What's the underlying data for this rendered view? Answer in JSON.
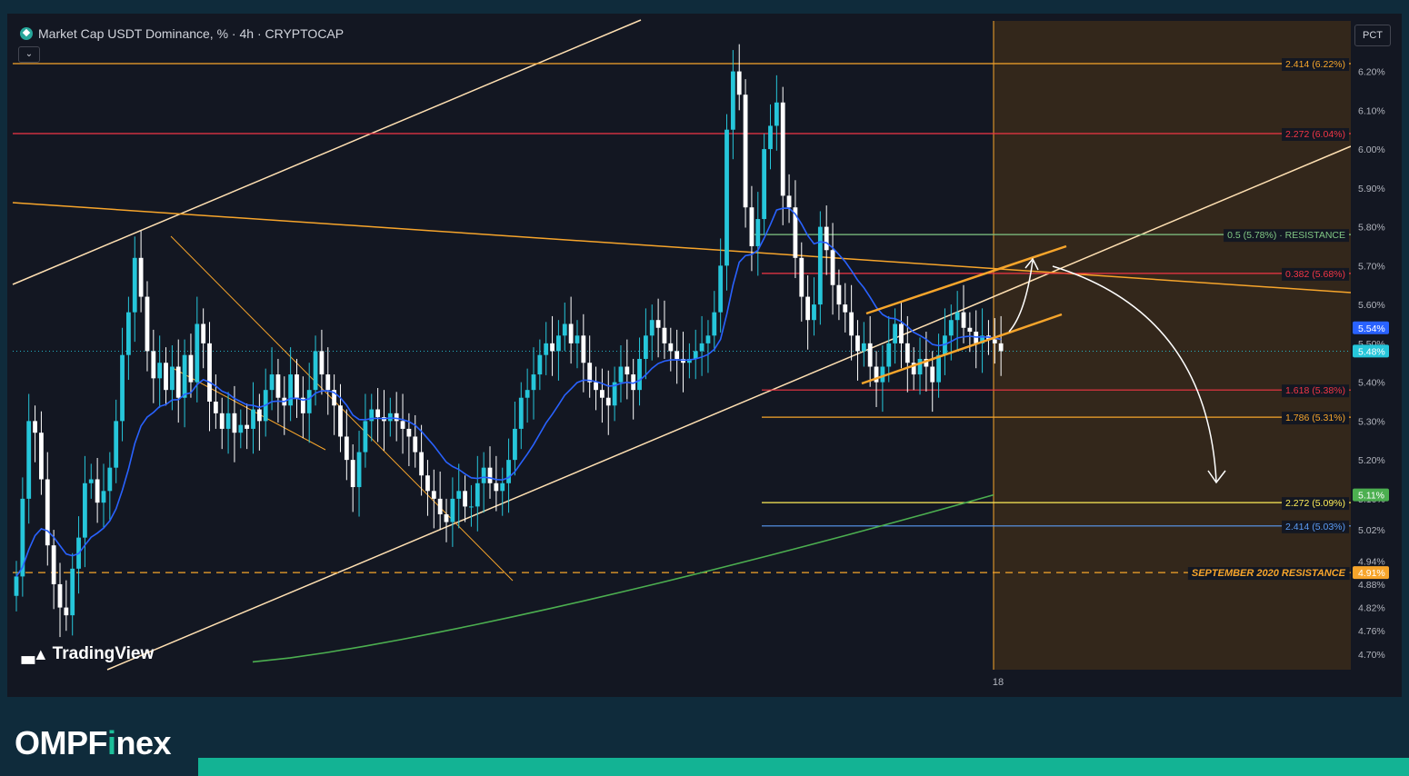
{
  "header": {
    "title": "Market Cap USDT Dominance, % · 4h · CRYPTOCAP",
    "collapse_icon": "chevron-down-icon",
    "scale_button": "PCT"
  },
  "watermark": "TradingView",
  "brand": {
    "name_pre": "OMPF",
    "name_accent": "i",
    "name_post": "nex"
  },
  "x_axis": {
    "tick_label": "18"
  },
  "colors": {
    "background": "#131722",
    "up": "#26c6da",
    "down": "#ffffff",
    "ema_fast": "#2962ff",
    "ema_slow": "#4caf50",
    "accent": "#13b394"
  },
  "chart_data": {
    "type": "candlestick",
    "title": "Market Cap USDT Dominance, % · 4h · CRYPTOCAP",
    "ylim": [
      4.66,
      6.33
    ],
    "y_ticks": [
      "6.20%",
      "6.10%",
      "6.00%",
      "5.90%",
      "5.80%",
      "5.70%",
      "5.60%",
      "5.50%",
      "5.40%",
      "5.30%",
      "5.20%",
      "5.10%",
      "5.02%",
      "4.94%",
      "4.88%",
      "4.82%",
      "4.76%",
      "4.70%"
    ],
    "price_labels": [
      {
        "text": "5.54%",
        "value": 5.54,
        "color": "#2962ff"
      },
      {
        "text": "5.48%",
        "value": 5.48,
        "color": "#26c6da"
      },
      {
        "text": "5.11%",
        "value": 5.11,
        "color": "#4caf50"
      },
      {
        "text": "4.91%",
        "value": 4.91,
        "color": "#f7a52b"
      }
    ],
    "levels": [
      {
        "label": "2.414 (6.22%)",
        "value": 6.22,
        "color": "#f7a52b"
      },
      {
        "label": "2.272 (6.04%)",
        "value": 6.04,
        "color": "#f23645"
      },
      {
        "label": "0.5 (5.78%) · RESISTANCE",
        "value": 5.78,
        "color": "#81c784"
      },
      {
        "label": "0.382 (5.68%)",
        "value": 5.68,
        "color": "#f23645"
      },
      {
        "label": "1.618 (5.38%)",
        "value": 5.38,
        "color": "#f23645"
      },
      {
        "label": "1.786 (5.31%)",
        "value": 5.31,
        "color": "#f7a52b"
      },
      {
        "label": "2.272 (5.09%)",
        "value": 5.09,
        "color": "#ffee58"
      },
      {
        "label": "2.414 (5.03%)",
        "value": 5.03,
        "color": "#5b9cf5"
      },
      {
        "label": "SEPTEMBER 2020 RESISTANCE",
        "value": 4.91,
        "color": "#f7a52b"
      }
    ],
    "series_close": [
      4.9,
      5.1,
      5.3,
      5.27,
      5.15,
      4.98,
      4.88,
      4.82,
      4.8,
      4.92,
      5.0,
      5.14,
      5.15,
      5.09,
      5.12,
      5.18,
      5.3,
      5.47,
      5.58,
      5.72,
      5.62,
      5.48,
      5.41,
      5.45,
      5.38,
      5.44,
      5.36,
      5.47,
      5.4,
      5.55,
      5.5,
      5.35,
      5.32,
      5.28,
      5.32,
      5.27,
      5.29,
      5.28,
      5.33,
      5.3,
      5.38,
      5.42,
      5.36,
      5.34,
      5.42,
      5.36,
      5.32,
      5.38,
      5.48,
      5.42,
      5.38,
      5.34,
      5.26,
      5.2,
      5.13,
      5.22,
      5.3,
      5.33,
      5.31,
      5.3,
      5.32,
      5.3,
      5.28,
      5.26,
      5.22,
      5.16,
      5.12,
      5.1,
      5.06,
      5.04,
      5.1,
      5.12,
      5.08,
      5.08,
      5.14,
      5.18,
      5.14,
      5.12,
      5.14,
      5.2,
      5.28,
      5.36,
      5.38,
      5.42,
      5.47,
      5.5,
      5.48,
      5.52,
      5.55,
      5.5,
      5.52,
      5.45,
      5.4,
      5.38,
      5.36,
      5.34,
      5.4,
      5.44,
      5.42,
      5.38,
      5.46,
      5.52,
      5.56,
      5.54,
      5.5,
      5.48,
      5.46,
      5.45,
      5.46,
      5.48,
      5.5,
      5.52,
      5.58,
      5.7,
      6.05,
      6.2,
      6.14,
      5.85,
      5.75,
      5.82,
      6.0,
      6.06,
      6.12,
      5.88,
      5.85,
      5.72,
      5.62,
      5.56,
      5.6,
      5.8,
      5.74,
      5.65,
      5.6,
      5.58,
      5.52,
      5.48,
      5.5,
      5.44,
      5.4,
      5.44,
      5.5,
      5.55,
      5.5,
      5.45,
      5.42,
      5.46,
      5.44,
      5.4,
      5.47,
      5.52,
      5.56,
      5.58,
      5.54,
      5.53,
      5.5,
      5.52,
      5.51,
      5.5,
      5.48
    ]
  }
}
